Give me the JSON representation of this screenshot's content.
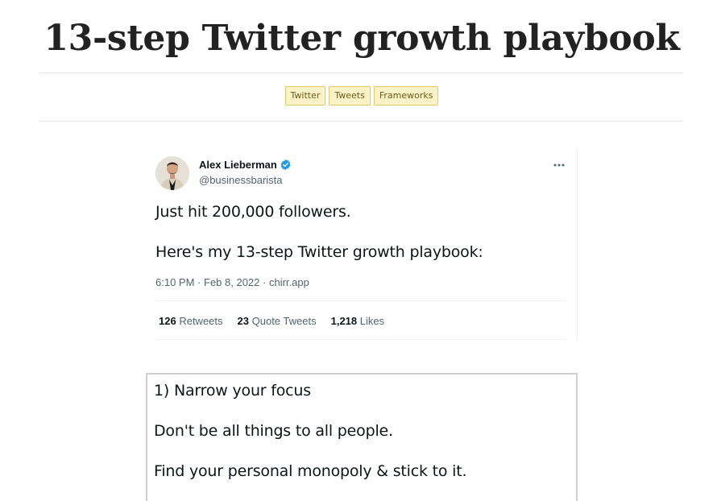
{
  "page": {
    "title": "13-step Twitter growth playbook",
    "tags": [
      "Twitter",
      "Tweets",
      "Frameworks"
    ]
  },
  "tweet": {
    "author_name": "Alex Lieberman",
    "handle": "@businessbarista",
    "verified": true,
    "text_lines": [
      "Just hit 200,000 followers.",
      "Here's my 13-step Twitter growth playbook:"
    ],
    "time": "6:10 PM",
    "date": "Feb 8, 2022",
    "source": "chirr.app",
    "stats": {
      "retweets_count": "126",
      "retweets_label": "Retweets",
      "quotes_count": "23",
      "quotes_label": "Quote Tweets",
      "likes_count": "1,218",
      "likes_label": "Likes"
    },
    "icons": [
      "verified-badge-icon",
      "more-options-icon"
    ],
    "colors": {
      "verified": "#1d9bf0",
      "text": "#0f1419",
      "secondary": "#536471"
    }
  },
  "thread_card": {
    "lines": [
      "1) Narrow your focus",
      "Don't be all things to all people.",
      "Find your personal monopoly & stick to it."
    ]
  },
  "colors": {
    "tag_background": "#fdf3c7",
    "tag_border": "#e3c96a",
    "tag_text": "#6b5a1e",
    "title": "#222222"
  }
}
